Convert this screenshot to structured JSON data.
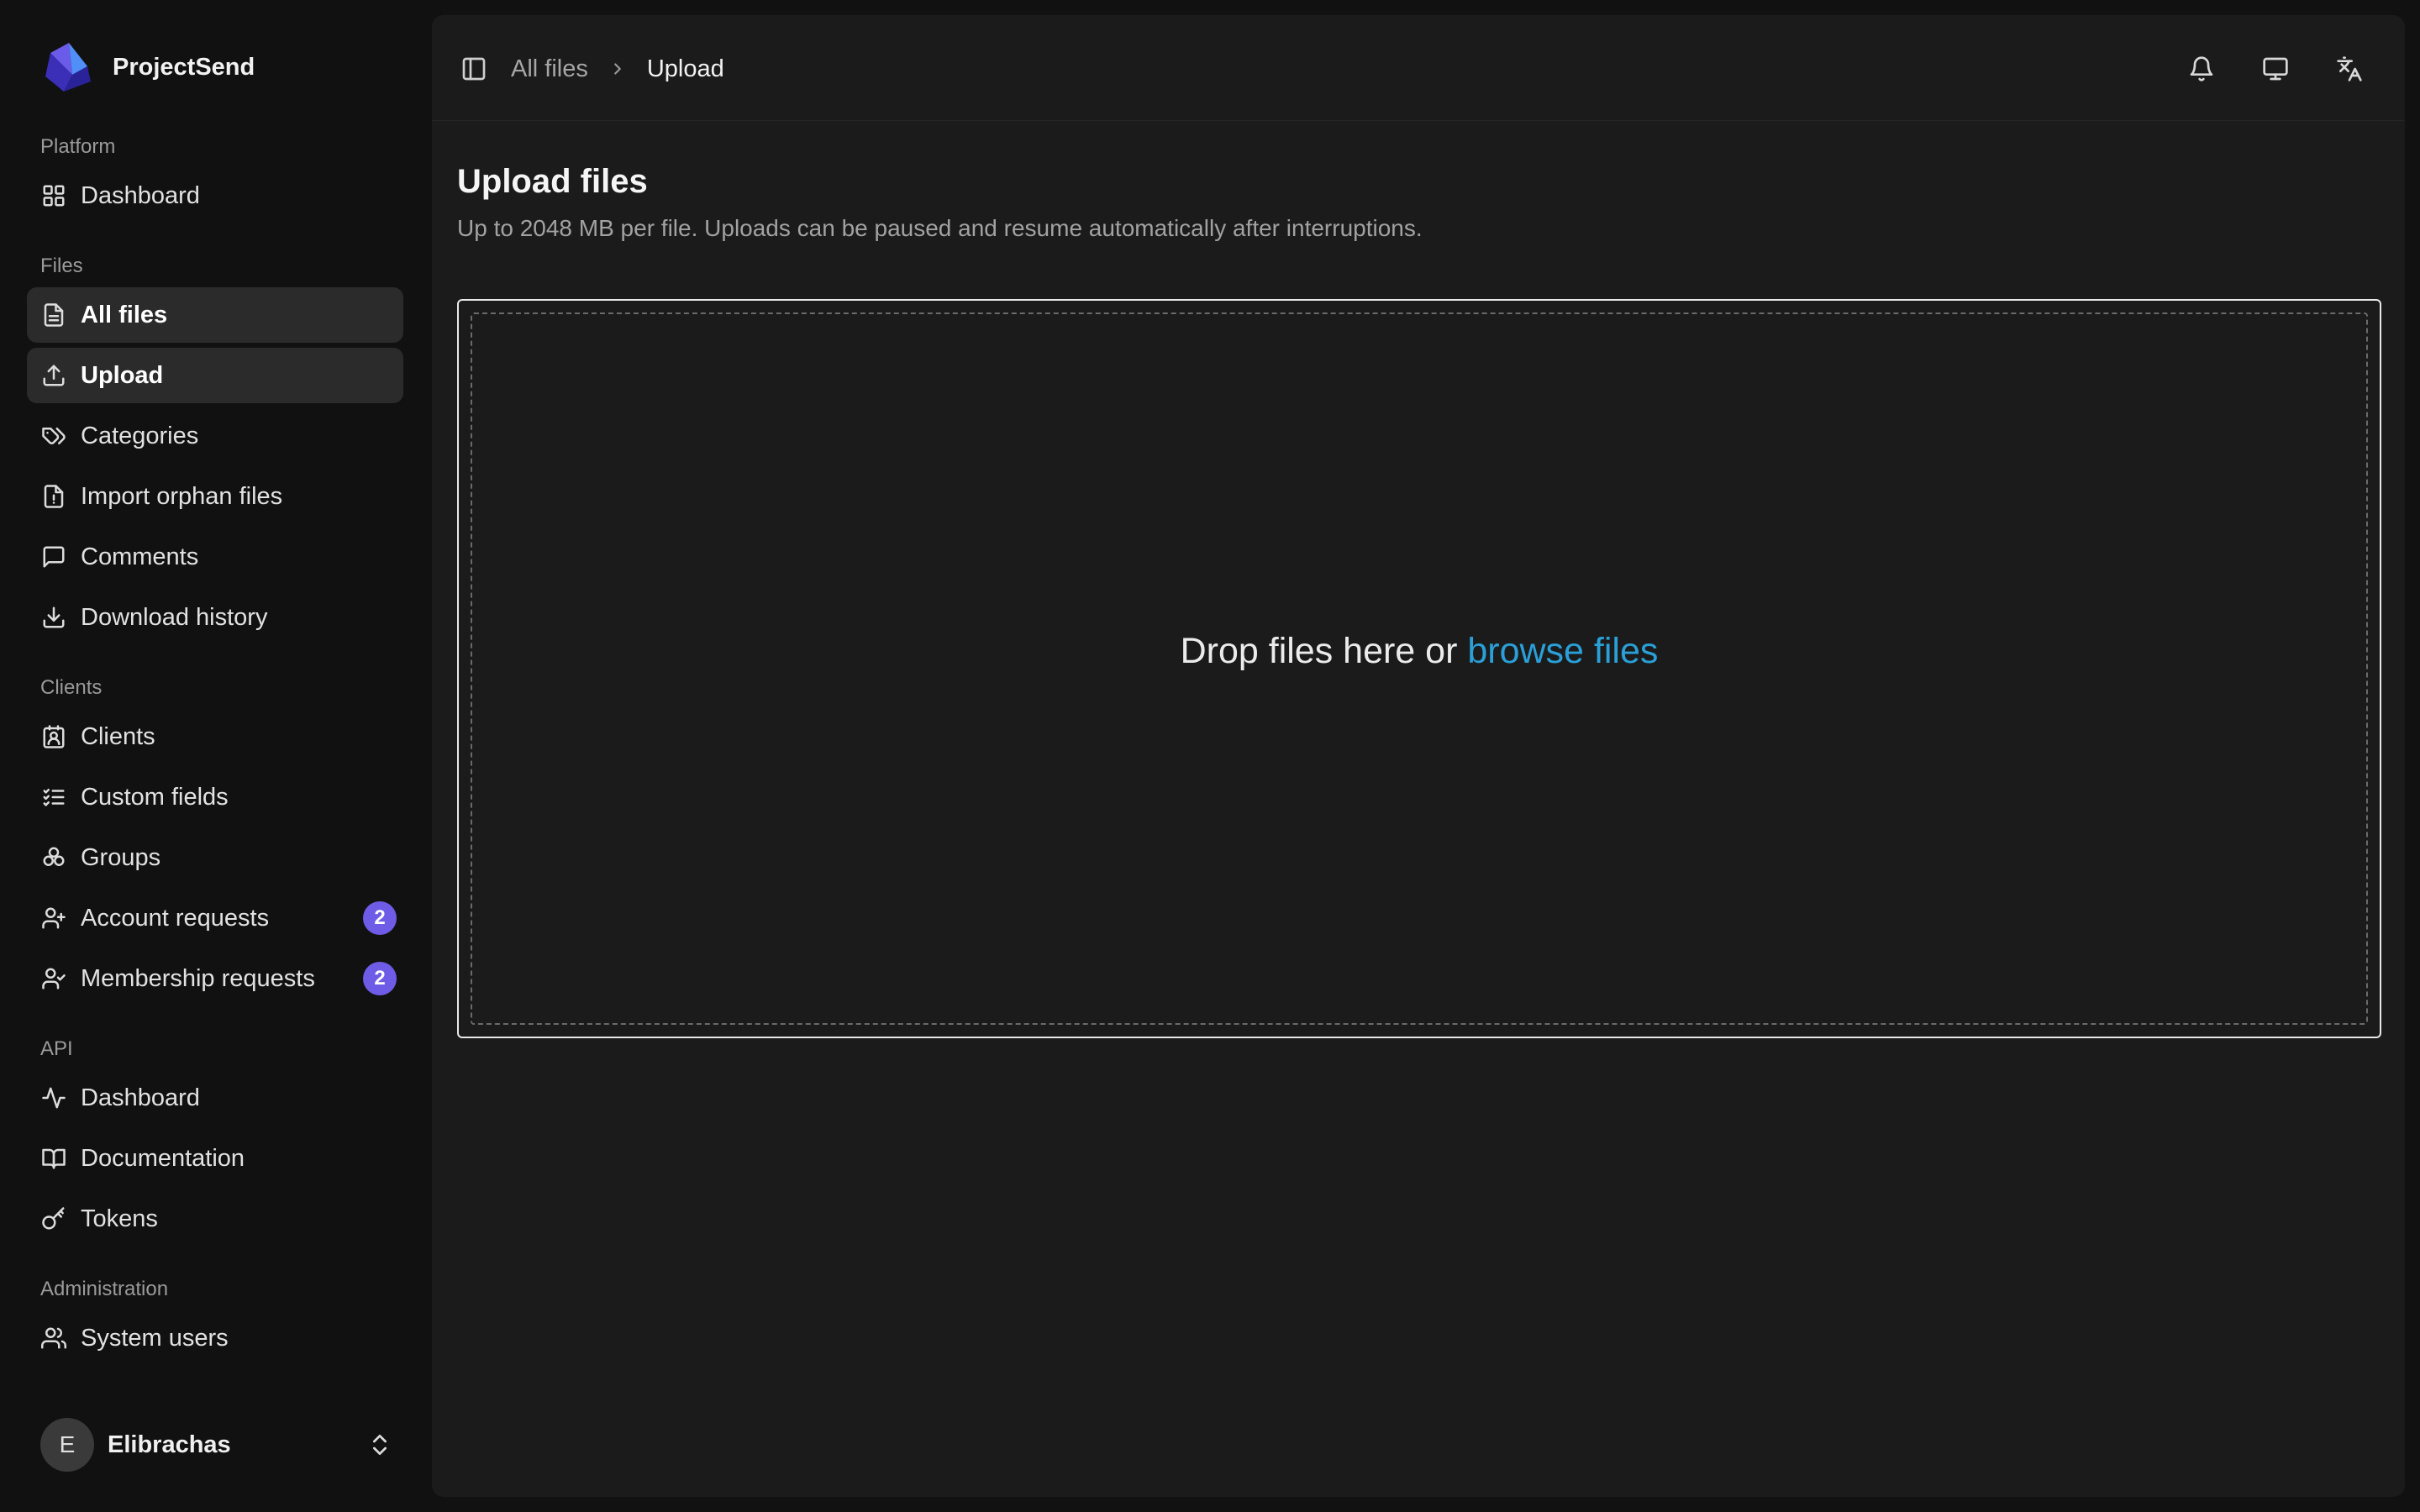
{
  "app": {
    "name": "ProjectSend"
  },
  "sidebar": {
    "sections": [
      {
        "label": "Platform",
        "items": [
          {
            "key": "platform-dashboard",
            "icon": "dashboard-grid-icon",
            "label": "Dashboard"
          }
        ]
      },
      {
        "label": "Files",
        "items": [
          {
            "key": "all-files",
            "icon": "file-icon",
            "label": "All files"
          },
          {
            "key": "upload",
            "icon": "upload-icon",
            "label": "Upload"
          },
          {
            "key": "categories",
            "icon": "tags-icon",
            "label": "Categories"
          },
          {
            "key": "import-orphan-files",
            "icon": "file-alert-icon",
            "label": "Import orphan files"
          },
          {
            "key": "comments",
            "icon": "comment-icon",
            "label": "Comments"
          },
          {
            "key": "download-history",
            "icon": "download-icon",
            "label": "Download history"
          }
        ]
      },
      {
        "label": "Clients",
        "items": [
          {
            "key": "clients",
            "icon": "contact-badge-icon",
            "label": "Clients"
          },
          {
            "key": "custom-fields",
            "icon": "checklist-icon",
            "label": "Custom fields"
          },
          {
            "key": "groups",
            "icon": "groups-icon",
            "label": "Groups"
          },
          {
            "key": "account-requests",
            "icon": "user-plus-icon",
            "label": "Account requests",
            "badge": "2"
          },
          {
            "key": "membership-requests",
            "icon": "user-check-icon",
            "label": "Membership requests",
            "badge": "2"
          }
        ]
      },
      {
        "label": "API",
        "items": [
          {
            "key": "api-dashboard",
            "icon": "activity-icon",
            "label": "Dashboard"
          },
          {
            "key": "documentation",
            "icon": "book-icon",
            "label": "Documentation"
          },
          {
            "key": "tokens",
            "icon": "key-icon",
            "label": "Tokens"
          }
        ]
      },
      {
        "label": "Administration",
        "items": [
          {
            "key": "system-users",
            "icon": "users-icon",
            "label": "System users"
          }
        ]
      }
    ],
    "active": [
      "all-files",
      "upload"
    ],
    "user": {
      "initial": "E",
      "name": "Elibrachas"
    }
  },
  "header": {
    "breadcrumb": {
      "parent": "All files",
      "current": "Upload"
    },
    "actions": [
      {
        "key": "notifications",
        "icon": "bell-icon"
      },
      {
        "key": "display",
        "icon": "monitor-icon"
      },
      {
        "key": "language",
        "icon": "translate-icon"
      }
    ]
  },
  "main": {
    "title": "Upload files",
    "subtitle": "Up to 2048 MB per file. Uploads can be paused and resume automatically after interruptions.",
    "dropzone": {
      "text": "Drop files here or",
      "link": "browse files"
    }
  },
  "colors": {
    "background": "#111111",
    "panel": "#1b1b1b",
    "active_item": "#2b2b2b",
    "badge": "#6e5ce6",
    "link": "#2a9fd8"
  }
}
